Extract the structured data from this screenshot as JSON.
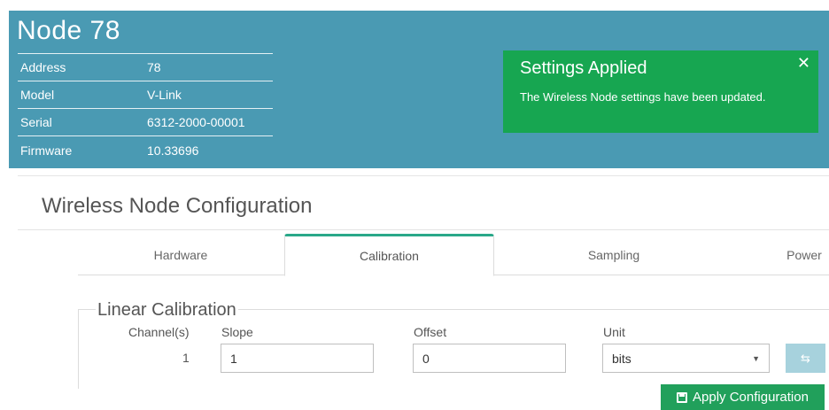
{
  "node": {
    "title": "Node 78",
    "info": [
      {
        "key": "Address",
        "value": "78"
      },
      {
        "key": "Model",
        "value": "V-Link"
      },
      {
        "key": "Serial",
        "value": "6312-2000-00001"
      },
      {
        "key": "Firmware",
        "value": "10.33696"
      }
    ]
  },
  "toast": {
    "title": "Settings Applied",
    "message": "The Wireless Node settings have been updated.",
    "close_glyph": "✕"
  },
  "panel": {
    "title": "Wireless Node Configuration",
    "tabs": [
      {
        "label": "Hardware"
      },
      {
        "label": "Calibration",
        "active": true
      },
      {
        "label": "Sampling"
      },
      {
        "label": "Power"
      }
    ]
  },
  "calibration": {
    "legend": "Linear Calibration",
    "columns": {
      "channel": "Channel(s)",
      "slope": "Slope",
      "offset": "Offset",
      "unit": "Unit"
    },
    "row": {
      "channel": "1",
      "slope": "1",
      "offset": "0",
      "unit": "bits"
    },
    "unit_button_icon": "arrow-swap-icon"
  },
  "actions": {
    "apply_label": "Apply Configuration"
  },
  "colors": {
    "header": "#4a9ab3",
    "toast": "#17a651",
    "active_tab_accent": "#2aa889",
    "apply_button": "#21a05b",
    "unit_button": "#a7d2dd"
  }
}
